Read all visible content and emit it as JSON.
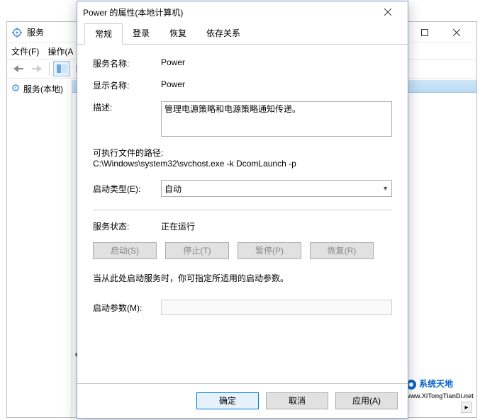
{
  "services_window": {
    "title": "服务",
    "menu": {
      "file": "文件(F)",
      "action": "操作(A"
    },
    "tree_item": "服务(本地)",
    "list_item": "e",
    "watermark_cn": "系统天地",
    "watermark_sub": "www.XiTongTianDi.net"
  },
  "dialog": {
    "title": "Power 的属性(本地计算机)",
    "tabs": [
      "常规",
      "登录",
      "恢复",
      "依存关系"
    ],
    "labels": {
      "service_name": "服务名称:",
      "display_name": "显示名称:",
      "description": "描述:",
      "exe_path": "可执行文件的路径:",
      "startup_type": "启动类型(E):",
      "service_status": "服务状态:",
      "start_params": "启动参数(M):"
    },
    "values": {
      "service_name": "Power",
      "display_name": "Power",
      "description": "管理电源策略和电源策略通知传递。",
      "exe_path": "C:\\Windows\\system32\\svchost.exe -k DcomLaunch -p",
      "startup_type_selected": "自动",
      "service_status": "正在运行"
    },
    "buttons": {
      "start": "启动(S)",
      "stop": "停止(T)",
      "pause": "暂停(P)",
      "resume": "恢复(R)"
    },
    "note": "当从此处启动服务时，你可指定所适用的启动参数。",
    "dlg_buttons": {
      "ok": "确定",
      "cancel": "取消",
      "apply": "应用(A)"
    }
  }
}
